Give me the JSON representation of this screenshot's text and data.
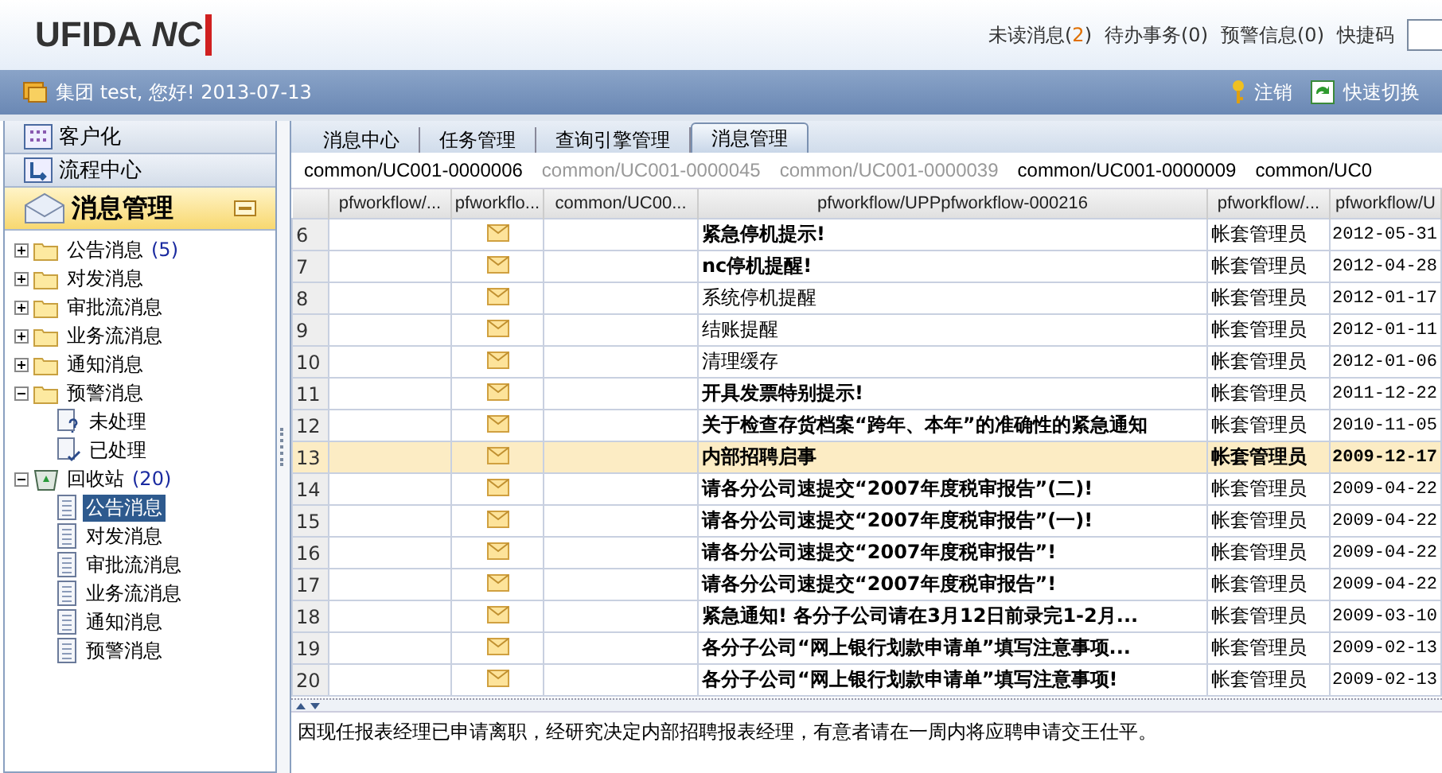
{
  "header": {
    "logo": "UFIDA",
    "logo_mark": "NC",
    "links": [
      {
        "label": "未读消息(",
        "count": "2",
        "tail": ")"
      },
      {
        "label": "待办事务(0)"
      },
      {
        "label": "预警信息(0)"
      }
    ],
    "shortcut_label": "快捷码"
  },
  "greeting_bar": {
    "greeting": "集团 test, 您好! 2013-07-13",
    "logout": "注销",
    "switch": "快速切换"
  },
  "sidebar": {
    "sections": [
      {
        "label": "客户化",
        "selected": false
      },
      {
        "label": "流程中心",
        "selected": false
      },
      {
        "label": "消息管理",
        "selected": true
      }
    ],
    "tree": [
      {
        "label": "公告消息",
        "count": "(5)",
        "kind": "folder",
        "expanded": false,
        "selected": false
      },
      {
        "label": "对发消息",
        "kind": "folder",
        "expanded": false,
        "selected": false
      },
      {
        "label": "审批流消息",
        "kind": "folder",
        "expanded": false,
        "selected": false
      },
      {
        "label": "业务流消息",
        "kind": "folder",
        "expanded": false,
        "selected": false
      },
      {
        "label": "通知消息",
        "kind": "folder",
        "expanded": false,
        "selected": false
      },
      {
        "label": "预警消息",
        "kind": "folder",
        "expanded": true,
        "selected": false,
        "children": [
          {
            "label": "未处理",
            "kind": "pending",
            "selected": false
          },
          {
            "label": "已处理",
            "kind": "done",
            "selected": false
          }
        ]
      },
      {
        "label": "回收站",
        "count": "(20)",
        "kind": "bin",
        "expanded": true,
        "selected": false,
        "children": [
          {
            "label": "公告消息",
            "kind": "doc",
            "selected": true
          },
          {
            "label": "对发消息",
            "kind": "doc",
            "selected": false
          },
          {
            "label": "审批流消息",
            "kind": "doc",
            "selected": false
          },
          {
            "label": "业务流消息",
            "kind": "doc",
            "selected": false
          },
          {
            "label": "通知消息",
            "kind": "doc",
            "selected": false
          },
          {
            "label": "预警消息",
            "kind": "doc",
            "selected": false
          }
        ]
      }
    ]
  },
  "tabs": [
    {
      "label": "消息中心",
      "selected": false
    },
    {
      "label": "任务管理",
      "selected": false
    },
    {
      "label": "查询引擎管理",
      "selected": false
    },
    {
      "label": "消息管理",
      "selected": true
    }
  ],
  "sub_tabs": [
    {
      "label": "common/UC001-0000006",
      "disabled": false
    },
    {
      "label": "common/UC001-0000045",
      "disabled": true
    },
    {
      "label": "common/UC001-0000039",
      "disabled": true
    },
    {
      "label": "common/UC001-0000009",
      "disabled": false
    },
    {
      "label": "common/UC0",
      "disabled": false
    }
  ],
  "table": {
    "columns": [
      "pfworkflow/...",
      "pfworkflo...",
      "common/UC00...",
      "pfworkflow/UPPpfworkflow-000216",
      "pfworkflow/...",
      "pfworkflow/U"
    ],
    "rows": [
      {
        "num": "6",
        "title": "紧急停机提示!",
        "author": "帐套管理员",
        "date": "2012-05-31",
        "unread": true,
        "selected": false
      },
      {
        "num": "7",
        "title": "nc停机提醒!",
        "author": "帐套管理员",
        "date": "2012-04-28",
        "unread": true,
        "selected": false
      },
      {
        "num": "8",
        "title": "系统停机提醒",
        "author": "帐套管理员",
        "date": "2012-01-17",
        "unread": false,
        "selected": false
      },
      {
        "num": "9",
        "title": "结账提醒",
        "author": "帐套管理员",
        "date": "2012-01-11",
        "unread": false,
        "selected": false
      },
      {
        "num": "10",
        "title": "清理缓存",
        "author": "帐套管理员",
        "date": "2012-01-06",
        "unread": false,
        "selected": false
      },
      {
        "num": "11",
        "title": "开具发票特别提示!",
        "author": "帐套管理员",
        "date": "2011-12-22",
        "unread": true,
        "selected": false
      },
      {
        "num": "12",
        "title": "关于检查存货档案“跨年、本年”的准确性的紧急通知",
        "author": "帐套管理员",
        "date": "2010-11-05",
        "unread": true,
        "selected": false
      },
      {
        "num": "13",
        "title": "内部招聘启事",
        "author": "帐套管理员",
        "date": "2009-12-17",
        "unread": true,
        "selected": true
      },
      {
        "num": "14",
        "title": "请各分公司速提交“2007年度税审报告”(二)!",
        "author": "帐套管理员",
        "date": "2009-04-22",
        "unread": true,
        "selected": false
      },
      {
        "num": "15",
        "title": "请各分公司速提交“2007年度税审报告”(一)!",
        "author": "帐套管理员",
        "date": "2009-04-22",
        "unread": true,
        "selected": false
      },
      {
        "num": "16",
        "title": "请各分公司速提交“2007年度税审报告”!",
        "author": "帐套管理员",
        "date": "2009-04-22",
        "unread": true,
        "selected": false
      },
      {
        "num": "17",
        "title": "请各分公司速提交“2007年度税审报告”!",
        "author": "帐套管理员",
        "date": "2009-04-22",
        "unread": true,
        "selected": false
      },
      {
        "num": "18",
        "title": "紧急通知!  各分子公司请在3月12日前录完1-2月...",
        "author": "帐套管理员",
        "date": "2009-03-10",
        "unread": true,
        "selected": false
      },
      {
        "num": "19",
        "title": "各分子公司“网上银行划款申请单”填写注意事项...",
        "author": "帐套管理员",
        "date": "2009-02-13",
        "unread": true,
        "selected": false
      },
      {
        "num": "20",
        "title": "各分子公司“网上银行划款申请单”填写注意事项!",
        "author": "帐套管理员",
        "date": "2009-02-13",
        "unread": true,
        "selected": false
      }
    ]
  },
  "preview": "因现任报表经理已申请离职，经研究决定内部招聘报表经理，有意者请在一周内将应聘申请交王仕平。"
}
